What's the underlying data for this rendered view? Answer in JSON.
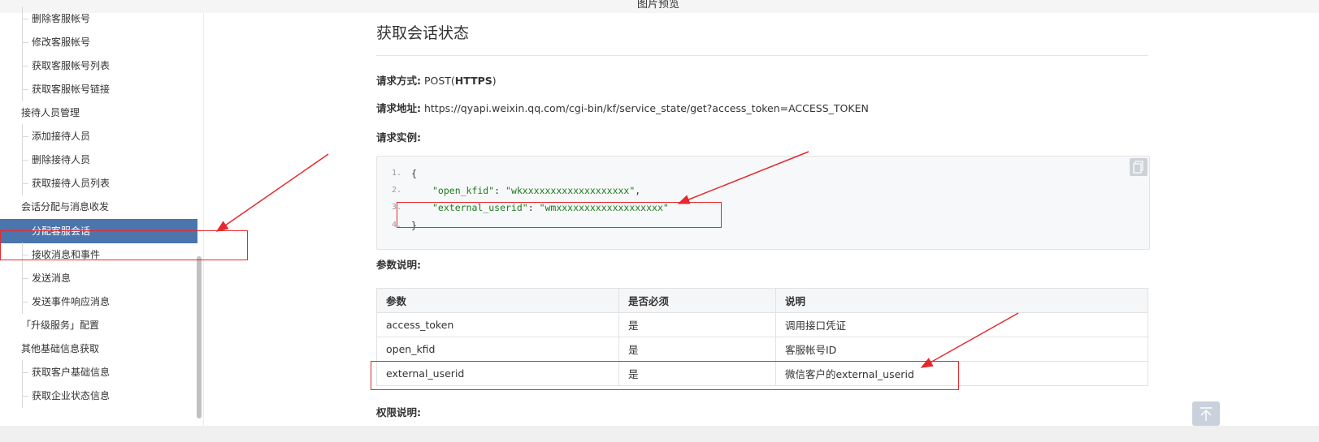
{
  "window": {
    "title": "图片预览"
  },
  "sidebar": {
    "items": [
      {
        "label": "删除客服帐号",
        "type": "sub"
      },
      {
        "label": "修改客服帐号",
        "type": "sub"
      },
      {
        "label": "获取客服帐号列表",
        "type": "sub"
      },
      {
        "label": "获取客服帐号链接",
        "type": "sub"
      },
      {
        "label": "接待人员管理",
        "type": "group"
      },
      {
        "label": "添加接待人员",
        "type": "sub"
      },
      {
        "label": "删除接待人员",
        "type": "sub"
      },
      {
        "label": "获取接待人员列表",
        "type": "sub"
      },
      {
        "label": "会话分配与消息收发",
        "type": "group"
      },
      {
        "label": "分配客服会话",
        "type": "active"
      },
      {
        "label": "接收消息和事件",
        "type": "sub"
      },
      {
        "label": "发送消息",
        "type": "sub"
      },
      {
        "label": "发送事件响应消息",
        "type": "sub"
      },
      {
        "label": "「升级服务」配置",
        "type": "group"
      },
      {
        "label": "其他基础信息获取",
        "type": "group"
      },
      {
        "label": "获取客户基础信息",
        "type": "sub"
      },
      {
        "label": "获取企业状态信息",
        "type": "sub"
      }
    ]
  },
  "main": {
    "title": "获取会话状态",
    "method_label": "请求方式:",
    "method_value": " POST(",
    "method_https": "HTTPS",
    "method_close": ")",
    "url_label": "请求地址:",
    "url_value": " https://qyapi.weixin.qq.com/cgi-bin/kf/service_state/get?access_token=ACCESS_TOKEN",
    "example_label": "请求实例:",
    "code_lines": [
      {
        "num": "1.",
        "text": "{"
      },
      {
        "num": "2.",
        "key": "\"open_kfid\"",
        "sep": ": ",
        "val": "\"wkxxxxxxxxxxxxxxxxxxx\"",
        "end": ","
      },
      {
        "num": "3.",
        "key": "\"external_userid\"",
        "sep": ": ",
        "val": "\"wmxxxxxxxxxxxxxxxxxxx\"",
        "end": ""
      },
      {
        "num": "4.",
        "text": "}"
      }
    ],
    "params_label": "参数说明:",
    "table": {
      "headers": [
        "参数",
        "是否必须",
        "说明"
      ],
      "rows": [
        [
          "access_token",
          "是",
          "调用接口凭证"
        ],
        [
          "open_kfid",
          "是",
          "客服帐号ID"
        ],
        [
          "external_userid",
          "是",
          "微信客户的external_userid"
        ]
      ]
    },
    "permission_label": "权限说明:"
  },
  "colors": {
    "accent": "#4a75ad",
    "annotation": "#e5292c",
    "code_string": "#1d7a1d"
  },
  "icons": {
    "copy": "copy-icon",
    "back_to_top": "arrow-up-icon",
    "minimize": "minimize-icon"
  }
}
